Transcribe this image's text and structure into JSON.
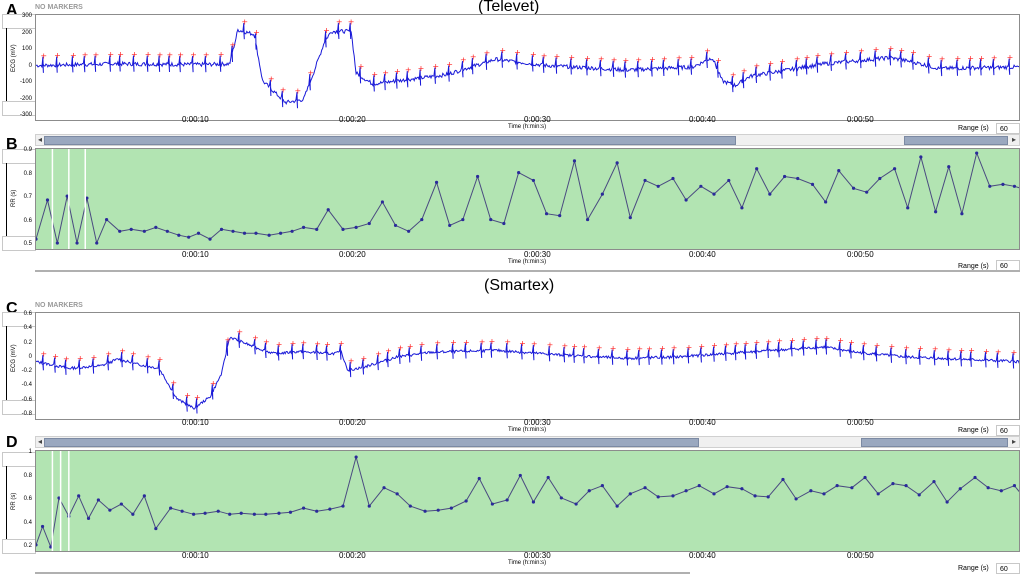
{
  "titles": {
    "top": "(Televet)",
    "bottom": "(Smartex)"
  },
  "no_markers": "NO MARKERS",
  "range_label": "Range (s)",
  "range_value": "60",
  "xlabel": "Time (h:min:s)",
  "x_ticks": [
    "0:00:10",
    "0:00:20",
    "0:00:30",
    "0:00:40",
    "0:00:50"
  ],
  "colors": {
    "ecg_line": "#1a1ad8",
    "marker": "#ff2020",
    "rr_line": "#4a4a80",
    "rr_point": "#2a2a9a",
    "rr_bg": "#b2e4b2"
  },
  "panels": {
    "A": {
      "letter": "A",
      "ylabel": "ECG (mV)",
      "yticks": [
        "300",
        "200",
        "100",
        "0",
        "-100",
        "-200",
        "-300"
      ]
    },
    "B": {
      "letter": "B",
      "ylabel": "RR (s)",
      "yticks": [
        "0.9",
        "0.8",
        "0.7",
        "0.6",
        "0.5"
      ]
    },
    "C": {
      "letter": "C",
      "ylabel": "ECG (mV)",
      "yticks": [
        "0.6",
        "0.4",
        "0.2",
        "0",
        "-0.2",
        "-0.4",
        "-0.6",
        "-0.8"
      ]
    },
    "D": {
      "letter": "D",
      "ylabel": "RR (s)",
      "yticks": [
        "1",
        "0.8",
        "0.6",
        "0.4",
        "0.2"
      ]
    }
  },
  "chart_data": [
    {
      "type": "line",
      "panel": "A",
      "title": "(Televet)",
      "xlabel": "Time (h:min:s)",
      "ylabel": "ECG (mV)",
      "xlim": [
        0,
        60
      ],
      "ylim": [
        -320,
        320
      ],
      "baseline_knots": [
        [
          0,
          20
        ],
        [
          5,
          30
        ],
        [
          10,
          25
        ],
        [
          11.8,
          30
        ],
        [
          12.3,
          250
        ],
        [
          13.3,
          220
        ],
        [
          13.8,
          -80
        ],
        [
          15.2,
          -220
        ],
        [
          16.3,
          -200
        ],
        [
          17,
          0
        ],
        [
          17.6,
          180
        ],
        [
          18,
          240
        ],
        [
          19.2,
          240
        ],
        [
          19.5,
          -30
        ],
        [
          20.5,
          -100
        ],
        [
          25,
          -40
        ],
        [
          28,
          60
        ],
        [
          31,
          20
        ],
        [
          36,
          -10
        ],
        [
          40,
          10
        ],
        [
          41.2,
          70
        ],
        [
          41.8,
          -80
        ],
        [
          42.6,
          -110
        ],
        [
          43.5,
          -50
        ],
        [
          48,
          30
        ],
        [
          52,
          70
        ],
        [
          53.5,
          40
        ],
        [
          55,
          0
        ],
        [
          60,
          10
        ]
      ]
    },
    {
      "type": "line",
      "panel": "B",
      "xlabel": "Time (h:min:s)",
      "ylabel": "RR (s)",
      "xlim": [
        0,
        60
      ],
      "ylim": [
        0.47,
        0.93
      ],
      "x": [
        0,
        0.7,
        1.3,
        1.9,
        2.5,
        3.1,
        3.7,
        4.3,
        5.1,
        5.8,
        6.6,
        7.3,
        8,
        8.7,
        9.3,
        9.9,
        10.6,
        11.3,
        12,
        12.7,
        13.4,
        14.2,
        14.9,
        15.6,
        16.3,
        17.1,
        17.8,
        18.7,
        19.5,
        20.3,
        21.1,
        21.9,
        22.7,
        23.5,
        24.4,
        25.2,
        26,
        26.9,
        27.7,
        28.5,
        29.4,
        30.3,
        31.1,
        31.9,
        32.8,
        33.6,
        34.5,
        35.4,
        36.2,
        37.1,
        37.9,
        38.8,
        39.6,
        40.5,
        41.3,
        42.2,
        43,
        43.9,
        44.7,
        45.6,
        46.4,
        47.3,
        48.1,
        48.9,
        49.8,
        50.6,
        51.4,
        52.3,
        53.1,
        53.9,
        54.8,
        55.6,
        56.4,
        57.3,
        58.1,
        58.9,
        59.6,
        60
      ],
      "values": [
        0.5,
        0.7,
        0.48,
        0.72,
        0.48,
        0.71,
        0.48,
        0.6,
        0.54,
        0.55,
        0.54,
        0.56,
        0.54,
        0.52,
        0.51,
        0.53,
        0.5,
        0.55,
        0.54,
        0.53,
        0.53,
        0.52,
        0.53,
        0.54,
        0.56,
        0.55,
        0.65,
        0.55,
        0.56,
        0.58,
        0.69,
        0.57,
        0.54,
        0.6,
        0.79,
        0.57,
        0.6,
        0.82,
        0.6,
        0.58,
        0.84,
        0.8,
        0.63,
        0.62,
        0.9,
        0.6,
        0.73,
        0.89,
        0.61,
        0.8,
        0.77,
        0.81,
        0.7,
        0.77,
        0.73,
        0.8,
        0.66,
        0.86,
        0.73,
        0.82,
        0.81,
        0.78,
        0.69,
        0.85,
        0.76,
        0.74,
        0.81,
        0.86,
        0.66,
        0.92,
        0.64,
        0.87,
        0.63,
        0.94,
        0.77,
        0.78,
        0.77,
        0.76
      ],
      "markers_at": [
        1.0,
        2.0,
        3.0
      ]
    },
    {
      "type": "line",
      "panel": "C",
      "title": "(Smartex)",
      "xlabel": "Time (h:min:s)",
      "ylabel": "ECG (mV)",
      "xlim": [
        0,
        60
      ],
      "ylim": [
        -0.85,
        0.65
      ],
      "baseline_knots": [
        [
          0,
          -0.02
        ],
        [
          2,
          -0.12
        ],
        [
          4,
          -0.08
        ],
        [
          5,
          0.02
        ],
        [
          6,
          -0.05
        ],
        [
          7.5,
          -0.12
        ],
        [
          8.6,
          -0.58
        ],
        [
          9.6,
          -0.72
        ],
        [
          10.6,
          -0.55
        ],
        [
          11.3,
          -0.2
        ],
        [
          11.8,
          0.35
        ],
        [
          12.3,
          0.3
        ],
        [
          13.3,
          0.2
        ],
        [
          14.5,
          0.1
        ],
        [
          16,
          0.13
        ],
        [
          18,
          0.1
        ],
        [
          18.6,
          0.12
        ],
        [
          19,
          -0.15
        ],
        [
          20,
          -0.1
        ],
        [
          22,
          0.05
        ],
        [
          24,
          0.12
        ],
        [
          28,
          0.15
        ],
        [
          32,
          0.08
        ],
        [
          36,
          0.03
        ],
        [
          39,
          0.05
        ],
        [
          42,
          0.1
        ],
        [
          45,
          0.15
        ],
        [
          48,
          0.2
        ],
        [
          50,
          0.12
        ],
        [
          53,
          0.05
        ],
        [
          56,
          0.02
        ],
        [
          60,
          -0.02
        ]
      ]
    },
    {
      "type": "line",
      "panel": "D",
      "xlabel": "Time (h:min:s)",
      "ylabel": "RR (s)",
      "xlim": [
        0,
        60
      ],
      "ylim": [
        0.18,
        1.1
      ],
      "x": [
        0,
        0.4,
        0.9,
        1.4,
        2,
        2.6,
        3.2,
        3.8,
        4.5,
        5.2,
        5.9,
        6.6,
        7.3,
        8.2,
        8.9,
        9.6,
        10.3,
        11.1,
        11.8,
        12.5,
        13.3,
        14,
        14.8,
        15.5,
        16.3,
        17.1,
        17.9,
        18.7,
        19.5,
        20.3,
        21.2,
        22,
        22.8,
        23.7,
        24.5,
        25.3,
        26.2,
        27,
        27.8,
        28.7,
        29.5,
        30.3,
        31.2,
        32,
        32.9,
        33.7,
        34.5,
        35.4,
        36.2,
        37.1,
        37.9,
        38.8,
        39.6,
        40.4,
        41.3,
        42.1,
        43,
        43.8,
        44.6,
        45.5,
        46.3,
        47.2,
        48,
        48.8,
        49.7,
        50.5,
        51.3,
        52.2,
        53,
        53.8,
        54.7,
        55.5,
        56.3,
        57.2,
        58,
        58.8,
        59.6,
        60
      ],
      "values": [
        0.22,
        0.4,
        0.2,
        0.68,
        0.5,
        0.7,
        0.48,
        0.66,
        0.56,
        0.62,
        0.52,
        0.7,
        0.38,
        0.58,
        0.55,
        0.52,
        0.53,
        0.55,
        0.52,
        0.53,
        0.52,
        0.52,
        0.53,
        0.54,
        0.58,
        0.55,
        0.57,
        0.6,
        1.08,
        0.6,
        0.78,
        0.72,
        0.6,
        0.55,
        0.56,
        0.58,
        0.65,
        0.87,
        0.62,
        0.66,
        0.9,
        0.64,
        0.88,
        0.68,
        0.62,
        0.75,
        0.8,
        0.6,
        0.72,
        0.78,
        0.69,
        0.7,
        0.75,
        0.8,
        0.72,
        0.79,
        0.77,
        0.7,
        0.69,
        0.86,
        0.67,
        0.75,
        0.72,
        0.8,
        0.78,
        0.88,
        0.72,
        0.82,
        0.8,
        0.71,
        0.84,
        0.64,
        0.77,
        0.88,
        0.78,
        0.75,
        0.8,
        0.72
      ],
      "markers_at": [
        1.0,
        1.5,
        2.0
      ]
    }
  ]
}
